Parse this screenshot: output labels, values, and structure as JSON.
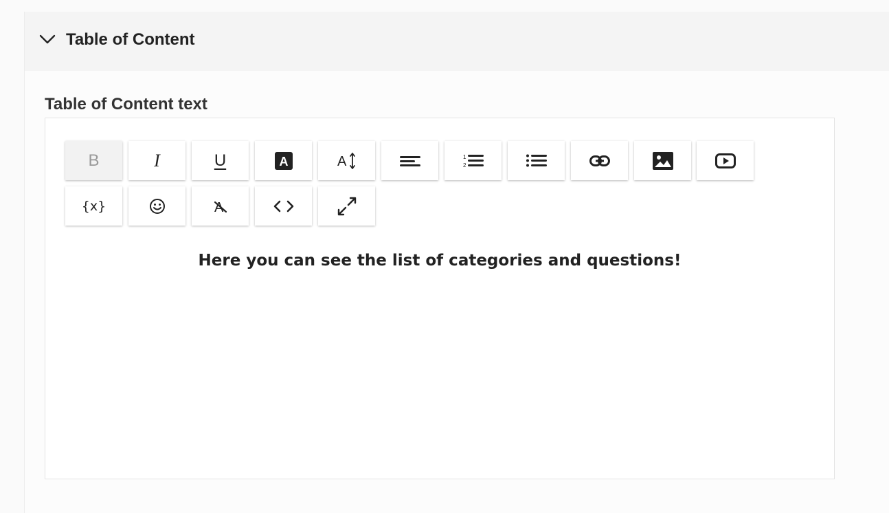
{
  "panel": {
    "title": "Table of Content",
    "expanded": true
  },
  "field": {
    "label": "Table of Content text"
  },
  "toolbar": {
    "row1": [
      {
        "name": "bold-button",
        "icon": "bold-icon",
        "glyph": "B",
        "active": true
      },
      {
        "name": "italic-button",
        "icon": "italic-icon",
        "glyph": "I",
        "active": false
      },
      {
        "name": "underline-button",
        "icon": "underline-icon",
        "glyph": "U",
        "active": false
      },
      {
        "name": "text-color-button",
        "icon": "text-color-icon",
        "glyph": "A",
        "active": false
      },
      {
        "name": "font-size-button",
        "icon": "font-size-icon",
        "glyph": "A",
        "active": false
      },
      {
        "name": "align-button",
        "icon": "align-left-icon",
        "glyph": "",
        "active": false
      },
      {
        "name": "ordered-list-button",
        "icon": "ordered-list-icon",
        "glyph": "",
        "active": false
      },
      {
        "name": "unordered-list-button",
        "icon": "unordered-list-icon",
        "glyph": "",
        "active": false
      },
      {
        "name": "link-button",
        "icon": "link-icon",
        "glyph": "",
        "active": false
      },
      {
        "name": "image-button",
        "icon": "image-icon",
        "glyph": "",
        "active": false
      },
      {
        "name": "video-button",
        "icon": "video-icon",
        "glyph": "",
        "active": false
      }
    ],
    "row2": [
      {
        "name": "variable-button",
        "icon": "variable-icon",
        "glyph": "{x}",
        "active": false
      },
      {
        "name": "emoji-button",
        "icon": "emoji-icon",
        "glyph": "",
        "active": false
      },
      {
        "name": "clear-format-button",
        "icon": "clear-format-icon",
        "glyph": "A",
        "active": false
      },
      {
        "name": "code-view-button",
        "icon": "code-icon",
        "glyph": "",
        "active": false
      },
      {
        "name": "fullscreen-button",
        "icon": "fullscreen-icon",
        "glyph": "",
        "active": false
      }
    ]
  },
  "editor": {
    "content": "Here you can see the list of categories and questions!"
  },
  "colors": {
    "header_bg": "#f4f4f4",
    "bold_inactive_glyph": "#999999",
    "text": "#222222"
  }
}
